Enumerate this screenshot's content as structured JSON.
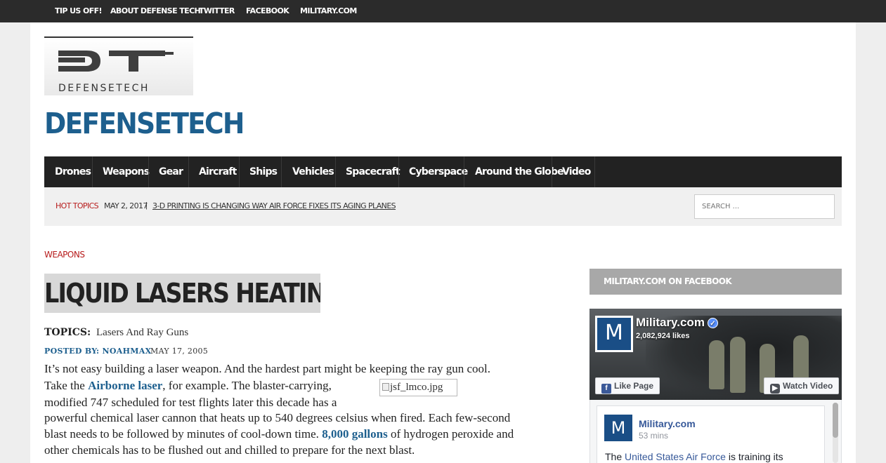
{
  "topnav": [
    "TIP US OFF!",
    "ABOUT DEFENSE TECH",
    "TWITTER",
    "FACEBOOK",
    "MILITARY.COM"
  ],
  "logo": {
    "wordmark": "DEFENSETECH"
  },
  "site_title": "DEFENSETECH",
  "main_nav": [
    "Drones",
    "Weapons",
    "Gear",
    "Aircraft",
    "Ships",
    "Vehicles",
    "Spacecraft",
    "Cyberspace",
    "Around the Globe",
    "Video"
  ],
  "hot_topics": {
    "label": "HOT TOPICS",
    "date": "MAY 2, 2017",
    "separator": "|",
    "headline": "3-D PRINTING IS CHANGING WAY AIR FORCE FIXES ITS AGING PLANES"
  },
  "search": {
    "placeholder": "SEARCH ..."
  },
  "article": {
    "category": "WEAPONS",
    "title": "LIQUID LASERS HEATING UP",
    "topics_label": "TOPICS:",
    "topics_value": "Lasers And Ray Guns",
    "posted_by": "POSTED BY: NOAHMAX",
    "date": "MAY 17, 2005",
    "image_alt": "jsf_lmco.jpg",
    "line1": "It’s not easy building a laser weapon. And the hardest part might be keeping the ray gun cool.",
    "line2_pre": "Take the ",
    "line2_link": "Airborne laser",
    "line2_post": ", for example. The blaster-carrying,",
    "line3": "modified 747 scheduled for test flights later this decade has a",
    "line4": "powerful chemical laser cannon that heats up to 540 degrees celsius when fired. Each few-second",
    "line5": "blast needs to be followed by minutes of cool-down time. ",
    "line5_link": "8,000 gallons",
    "line5_post": " of hydrogen peroxide and",
    "line6": "other chemicals has to be flushed out and chilled to prepare for the next blast."
  },
  "sidebar": {
    "heading": "MILITARY.COM ON FACEBOOK",
    "fb": {
      "logo_letter": "M",
      "page_name": "Military.com",
      "verified_glyph": "✓",
      "likes": "2,082,924 likes",
      "like_button": "Like Page",
      "like_icon_glyph": "f",
      "video_button": "Watch Video",
      "video_icon_glyph": "▶",
      "post_name": "Military.com",
      "post_time": "53 mins",
      "post_text_pre": "The ",
      "post_text_link": "United States Air Force",
      "post_text_post": " is training its"
    }
  }
}
